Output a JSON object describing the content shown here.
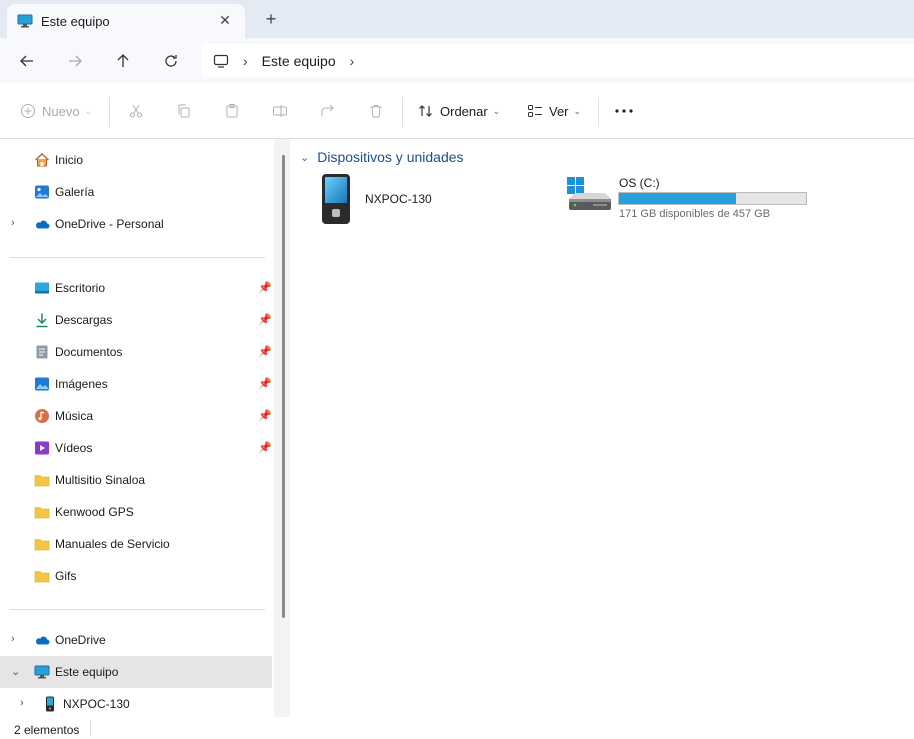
{
  "window": {
    "tab_title": "Este equipo",
    "tab_close_icon": "close-icon",
    "new_tab_icon": "plus-icon"
  },
  "nav": {
    "back_icon": "arrow-left-icon",
    "forward_icon": "arrow-right-icon",
    "up_icon": "arrow-up-icon",
    "refresh_icon": "refresh-icon",
    "breadcrumb": [
      "Este equipo"
    ]
  },
  "toolbar": {
    "new_label": "Nuevo",
    "sort_label": "Ordenar",
    "view_label": "Ver",
    "more_icon": "more-icon",
    "disabled_icons": [
      "cut-icon",
      "copy-icon",
      "paste-icon",
      "rename-icon",
      "share-icon",
      "delete-icon"
    ]
  },
  "sidebar": {
    "top": [
      {
        "label": "Inicio",
        "icon": "home-icon"
      },
      {
        "label": "Galería",
        "icon": "gallery-icon"
      },
      {
        "label": "OneDrive - Personal",
        "icon": "cloud-icon"
      }
    ],
    "quick": [
      {
        "label": "Escritorio",
        "icon": "desktop-icon",
        "pinned": true
      },
      {
        "label": "Descargas",
        "icon": "download-icon",
        "pinned": true
      },
      {
        "label": "Documentos",
        "icon": "documents-icon",
        "pinned": true
      },
      {
        "label": "Imágenes",
        "icon": "pictures-icon",
        "pinned": true
      },
      {
        "label": "Música",
        "icon": "music-icon",
        "pinned": true
      },
      {
        "label": "Vídeos",
        "icon": "videos-icon",
        "pinned": true
      },
      {
        "label": "Multisitio Sinaloa",
        "icon": "folder-icon",
        "pinned": false
      },
      {
        "label": "Kenwood GPS",
        "icon": "folder-icon",
        "pinned": false
      },
      {
        "label": "Manuales de Servicio",
        "icon": "folder-icon",
        "pinned": false
      },
      {
        "label": "Gifs",
        "icon": "folder-icon",
        "pinned": false
      }
    ],
    "bottom": [
      {
        "label": "OneDrive",
        "icon": "cloud-icon"
      },
      {
        "label": "Este equipo",
        "icon": "pc-icon",
        "selected": true
      },
      {
        "label": "NXPOC-130",
        "icon": "phone-icon"
      }
    ]
  },
  "main": {
    "group_title": "Dispositivos y unidades",
    "devices": [
      {
        "name": "NXPOC-130",
        "icon": "phone-icon"
      },
      {
        "name": "OS (C:)",
        "icon": "drive-icon",
        "free_text": "171 GB disponibles de 457 GB",
        "used_fraction": 0.626
      }
    ]
  },
  "status": {
    "count": "2 elementos"
  },
  "colors": {
    "accent": "#26a0da",
    "group_header": "#1f4e8c",
    "selection": "#e5e5e5",
    "folder": "#f4c542"
  }
}
